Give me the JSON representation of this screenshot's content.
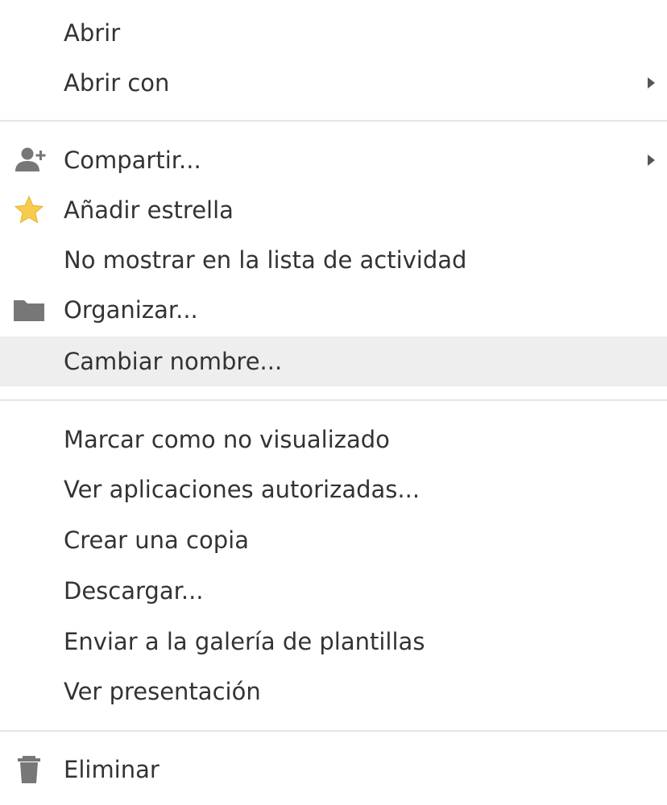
{
  "menu": {
    "items": [
      {
        "label": "Abrir"
      },
      {
        "label": "Abrir con",
        "submenu": true
      },
      {
        "label": "Compartir...",
        "icon": "add-person-icon",
        "submenu": true
      },
      {
        "label": "Añadir estrella",
        "icon": "star-icon"
      },
      {
        "label": "No mostrar en la lista de actividad"
      },
      {
        "label": "Organizar...",
        "icon": "folder-icon"
      },
      {
        "label": "Cambiar nombre...",
        "highlighted": true
      },
      {
        "label": "Marcar como no visualizado"
      },
      {
        "label": "Ver aplicaciones autorizadas..."
      },
      {
        "label": "Crear una copia"
      },
      {
        "label": "Descargar..."
      },
      {
        "label": "Enviar a la galería de plantillas"
      },
      {
        "label": "Ver presentación"
      },
      {
        "label": "Eliminar",
        "icon": "trash-icon"
      }
    ]
  },
  "colors": {
    "text": "#333333",
    "icon_gray": "#777777",
    "star": "#f7cb4d",
    "highlight_bg": "#eeeeee",
    "divider": "#e5e5e5"
  }
}
